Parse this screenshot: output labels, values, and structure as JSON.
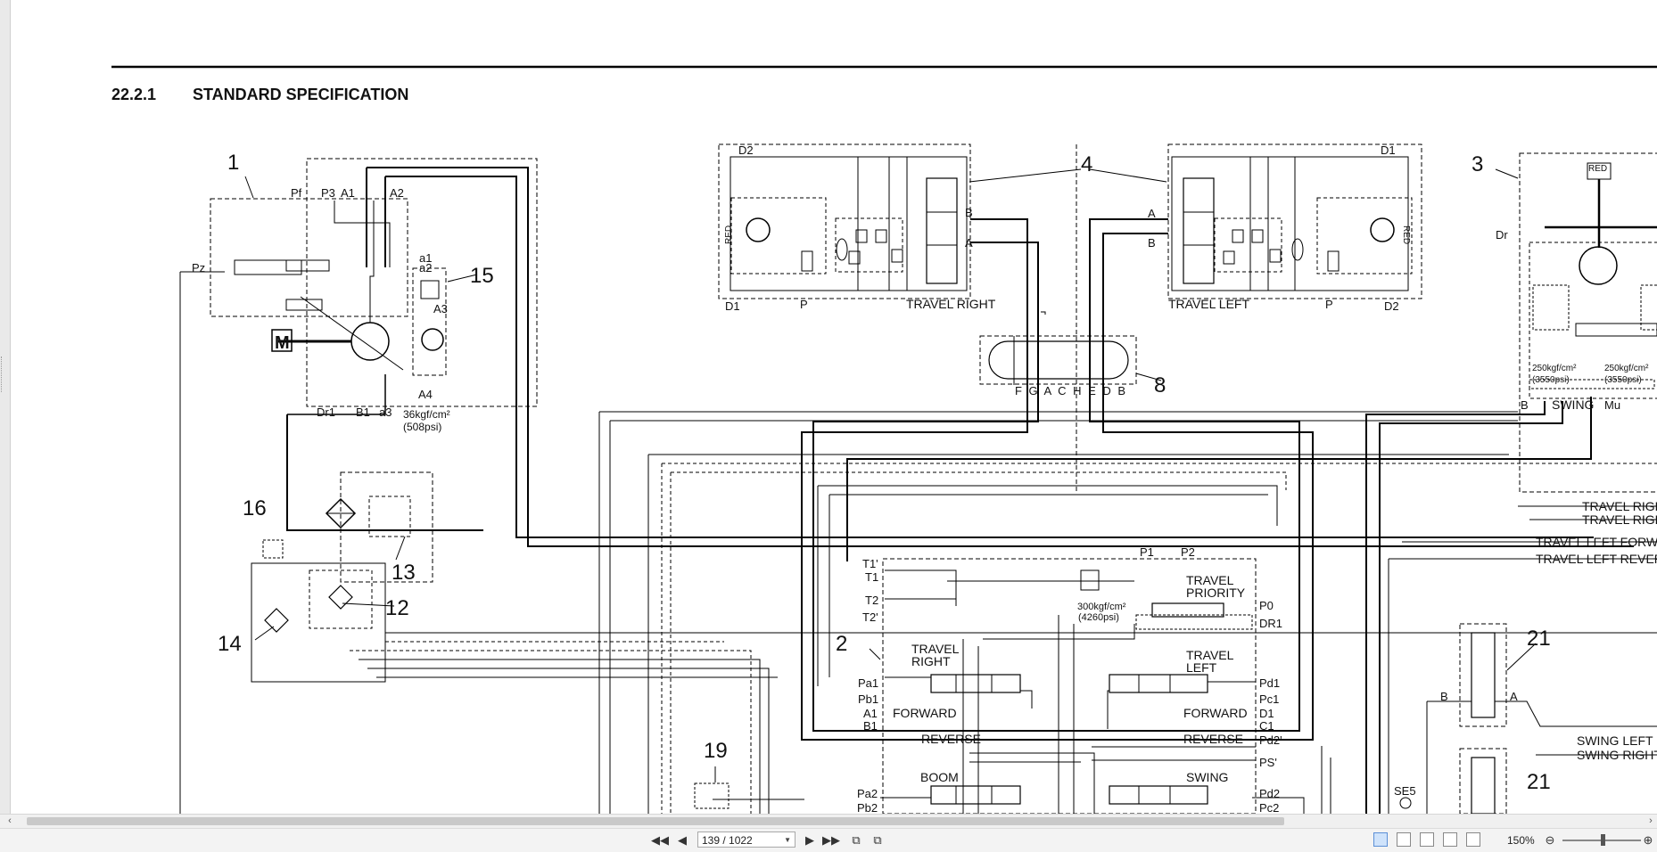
{
  "document": {
    "section_number": "22.2.1",
    "section_title": "STANDARD SPECIFICATION",
    "callouts": [
      "1",
      "4",
      "3",
      "15",
      "8",
      "16",
      "13",
      "12",
      "14",
      "2",
      "21",
      "19",
      "21"
    ],
    "labels": {
      "pf": "Pf",
      "p3": "P3",
      "a1": "A1",
      "a2": "A2",
      "pz": "Pz",
      "a1s": "a1",
      "a2s": "a2",
      "a3": "A3",
      "a4": "A4",
      "m": "M",
      "dr1": "Dr1",
      "b1": "B1",
      "a3s": "a3",
      "pump_pressure_1": "36kgf/cm²",
      "pump_pressure_2": "(508psi)",
      "d2": "D2",
      "d1": "D1",
      "b": "B",
      "a": "A",
      "p": "P",
      "red": "RED",
      "dr": "Dr",
      "b_swing": "B",
      "mu": "Mu",
      "travel_right": "TRAVEL RIGHT",
      "travel_left": "TRAVEL LEFT",
      "swing": "SWING",
      "swing_pressure_1": "250kgf/cm²",
      "swing_pressure_2": "(3550psi)",
      "joint_ports": "F G A C H E D B",
      "t1p": "T1'",
      "t1": "T1",
      "t2": "T2",
      "t2p": "T2'",
      "p1": "P1",
      "p2": "P2",
      "p0": "P0",
      "dr1c": "DR1",
      "mcv_pressure_1": "300kgf/cm²",
      "mcv_pressure_2": "(4260psi)",
      "travel_priority_1": "TRAVEL",
      "travel_priority_2": "PRIORITY",
      "travel_right_spool_1": "TRAVEL",
      "travel_right_spool_2": "RIGHT",
      "travel_left_spool_1": "TRAVEL",
      "travel_left_spool_2": "LEFT",
      "pa1": "Pa1",
      "pb1": "Pb1",
      "a1c": "A1",
      "b1c": "B1",
      "pd1": "Pd1",
      "pc1": "Pc1",
      "d1c": "D1",
      "c1": "C1",
      "forward": "FORWARD",
      "reverse": "REVERSE",
      "pd2p": "Pd2'",
      "psp": "PS'",
      "pd2": "Pd2",
      "pc2": "Pc2",
      "boom": "BOOM",
      "swing_spool": "SWING",
      "pa2": "Pa2",
      "pb2": "Pb2",
      "se5": "SE5",
      "b21": "B",
      "a21": "A",
      "line_travel_right_1": "TRAVEL RIGHT",
      "line_travel_right_2": "TRAVEL RIGHT",
      "line_travel_left_fwd": "TRAVEL LEFT FORWA",
      "line_travel_left_rev": "TRAVEL LEFT REVERS",
      "line_swing_left": "SWING LEFT",
      "line_swing_right": "SWING RIGHT"
    }
  },
  "viewer": {
    "page_indicator": "139 / 1022",
    "zoom": "150%"
  }
}
